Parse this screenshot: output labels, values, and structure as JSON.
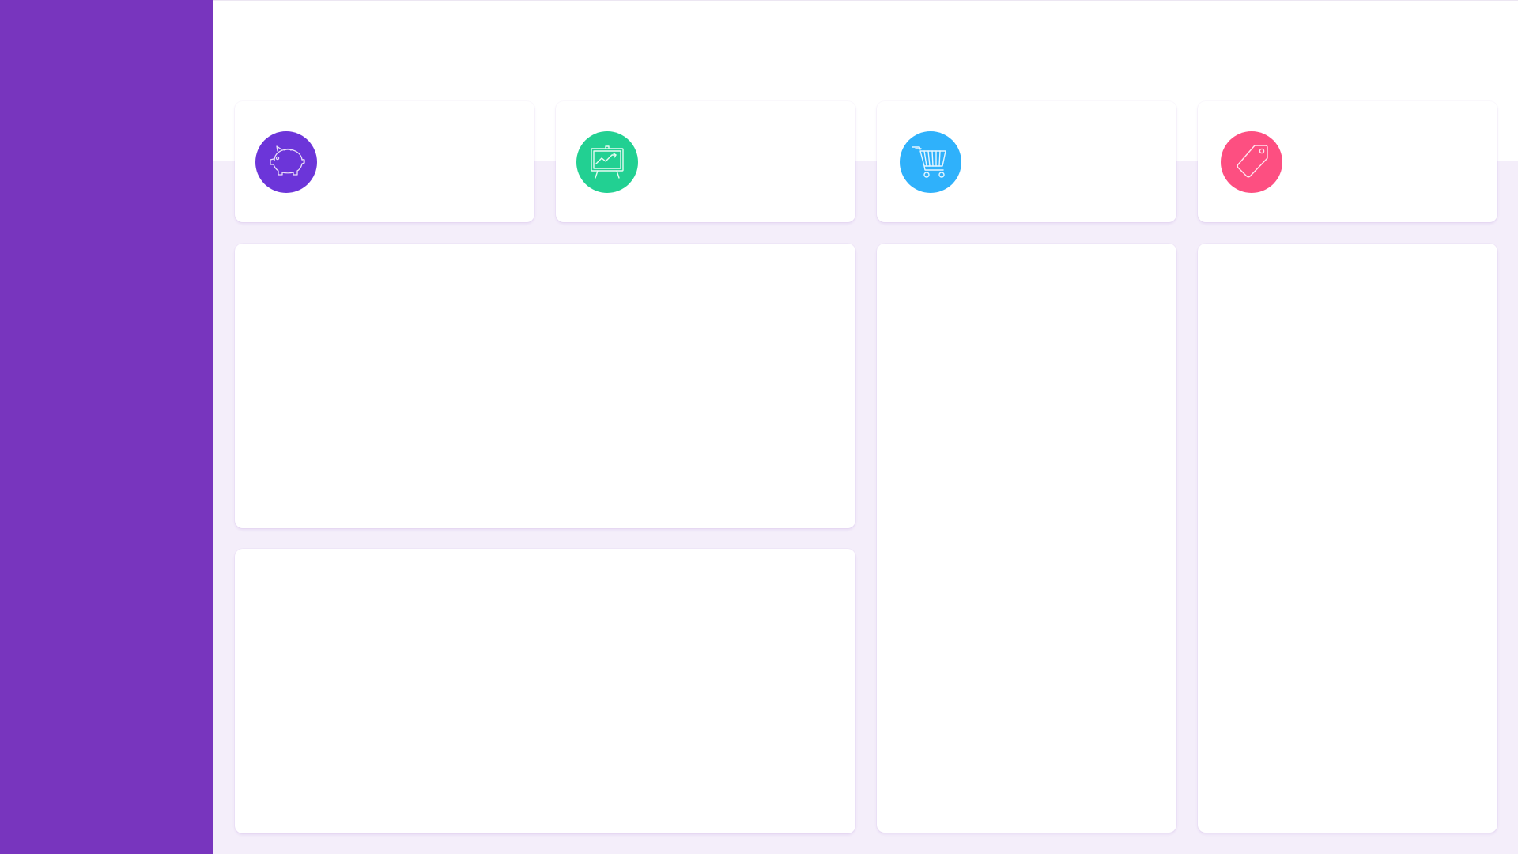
{
  "theme": {
    "sidebar_color": "#7835be",
    "header_color": "#ffffff",
    "page_background": "#f4eefa",
    "card_background": "#ffffff"
  },
  "stats": [
    {
      "icon": "piggy-bank-icon",
      "color": "#6c35d9"
    },
    {
      "icon": "presentation-chart-icon",
      "color": "#22d092"
    },
    {
      "icon": "shopping-cart-icon",
      "color": "#2fb1fb"
    },
    {
      "icon": "price-tag-icon",
      "color": "#fd4f81"
    }
  ]
}
